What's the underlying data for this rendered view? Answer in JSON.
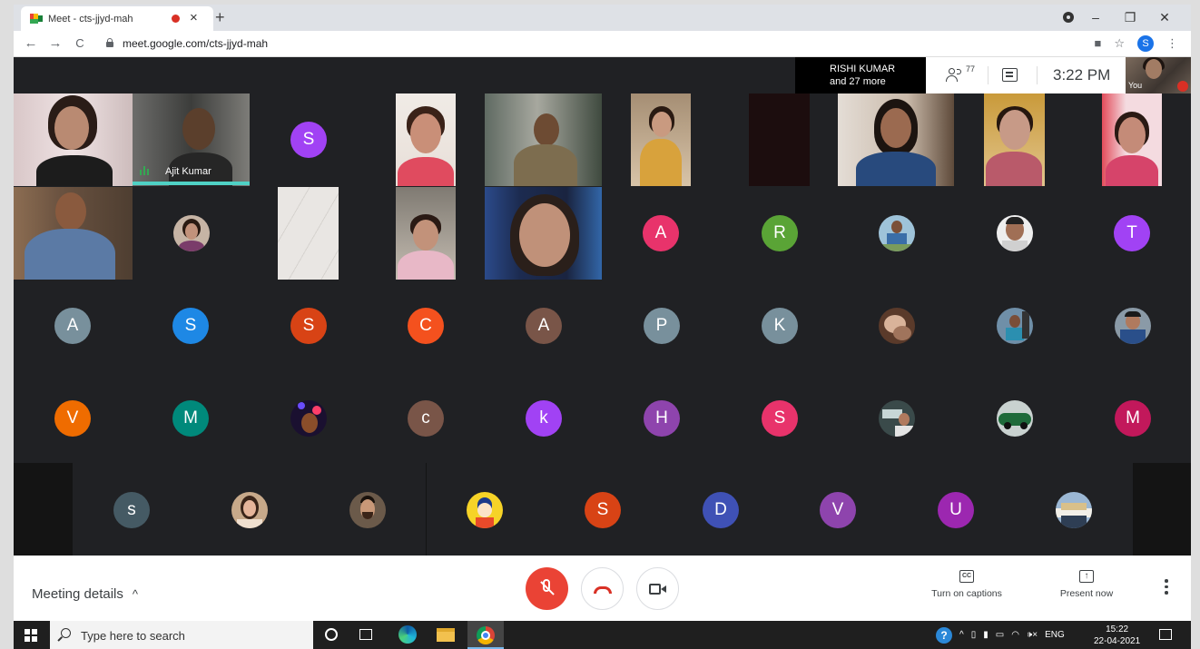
{
  "browser": {
    "tab_title": "Meet - cts-jjyd-mah",
    "tab_close": "×",
    "new_tab": "+",
    "url": "meet.google.com/cts-jjyd-mah",
    "profile_initial": "S",
    "nav": {
      "back": "←",
      "forward": "→",
      "reload": "C"
    },
    "window_controls": {
      "minimize": "–",
      "maximize": "❐",
      "close": "✕"
    }
  },
  "meet": {
    "presenter_name": "RISHI KUMAR",
    "presenter_sub": "and 27 more",
    "people_count": "77",
    "time": "3:22 PM",
    "self_label": "You",
    "speaking_name": "Ajit Kumar",
    "avatars": {
      "r1c3": "S",
      "r2c6": "A",
      "r2c7": "R",
      "r2c10": "T",
      "r3c1": "A",
      "r3c2": "S",
      "r3c3": "S",
      "r3c4": "C",
      "r3c5": "A",
      "r3c6": "P",
      "r3c7": "K",
      "r4c1": "V",
      "r4c2": "M",
      "r4c4": "c",
      "r4c5": "k",
      "r4c6": "H",
      "r4c7": "S",
      "r4c10": "M",
      "r5c1": "s",
      "r5c5": "S",
      "r5c6": "D",
      "r5c7": "V",
      "r5c8": "U"
    },
    "colors": {
      "bg": "#202124",
      "mic_off": "#ea4335",
      "speaking": "#4fd1c5"
    }
  },
  "bottom_bar": {
    "meeting_details": "Meeting details",
    "meeting_details_chevron": "^",
    "captions_label": "Turn on captions",
    "captions_icon": "CC",
    "present_label": "Present now",
    "present_icon": "↑"
  },
  "taskbar": {
    "search_placeholder": "Type here to search",
    "help": "?",
    "tray_arrow": "^",
    "lang": "ENG",
    "speaker": "🕩×",
    "time": "15:22",
    "date": "22-04-2021"
  }
}
